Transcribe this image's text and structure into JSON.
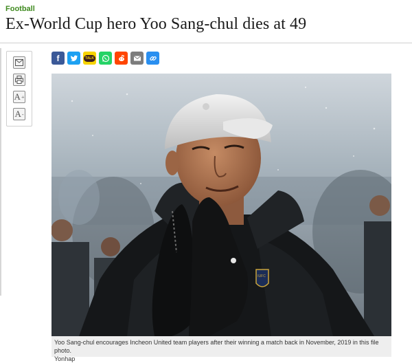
{
  "section": {
    "category": "Football"
  },
  "article": {
    "headline": "Ex-World Cup hero Yoo Sang-chul dies at 49",
    "caption": "Yoo Sang-chul encourages Incheon United team players after their winning a match back in November, 2019 in this file photo.",
    "credit": "Yonhap",
    "badge_text": "IUFC"
  },
  "tools": [
    {
      "name": "email-icon"
    },
    {
      "name": "print-icon"
    },
    {
      "name": "font-increase-icon",
      "glyph": "A",
      "mod": "+"
    },
    {
      "name": "font-decrease-icon",
      "glyph": "A",
      "mod": "-"
    }
  ],
  "share": [
    {
      "name": "facebook-share-icon",
      "color": "#3b5998",
      "glyph": "f"
    },
    {
      "name": "twitter-share-icon",
      "color": "#1da1f2"
    },
    {
      "name": "kakaotalk-share-icon",
      "color": "#f7d400",
      "glyph": "TALK"
    },
    {
      "name": "whatsapp-share-icon",
      "color": "#25d366"
    },
    {
      "name": "reddit-share-icon",
      "color": "#ff4500"
    },
    {
      "name": "email-share-icon",
      "color": "#7d7d7d"
    },
    {
      "name": "link-share-icon",
      "color": "#2a8ff0"
    }
  ]
}
